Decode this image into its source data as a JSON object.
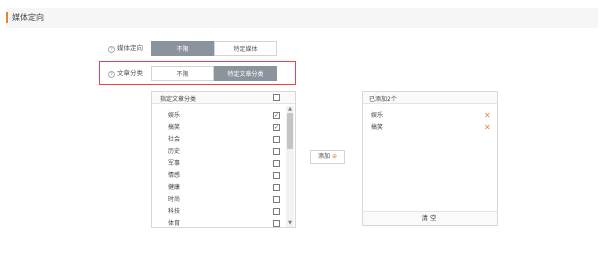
{
  "header": {
    "title": "媒体定向"
  },
  "media_targeting": {
    "label": "媒体定向",
    "options": [
      {
        "label": "不限",
        "active": true
      },
      {
        "label": "特定媒体",
        "active": false
      }
    ]
  },
  "article_category": {
    "label": "文章分类",
    "options": [
      {
        "label": "不限",
        "active": false
      },
      {
        "label": "特定文章分类",
        "active": true
      }
    ]
  },
  "category_list": {
    "header_label": "指定文章分类",
    "items": [
      {
        "label": "娱乐",
        "checked": true
      },
      {
        "label": "搞笑",
        "checked": true
      },
      {
        "label": "社会",
        "checked": false
      },
      {
        "label": "历史",
        "checked": false
      },
      {
        "label": "军事",
        "checked": false
      },
      {
        "label": "情感",
        "checked": false
      },
      {
        "label": "健康",
        "checked": false
      },
      {
        "label": "时尚",
        "checked": false
      },
      {
        "label": "科技",
        "checked": false
      },
      {
        "label": "体育",
        "checked": false
      }
    ]
  },
  "add_button": {
    "label": "添加"
  },
  "added_panel": {
    "header_label": "已添加2个",
    "items": [
      {
        "label": "娱乐"
      },
      {
        "label": "搞笑"
      }
    ],
    "clear_label": "清空"
  },
  "colors": {
    "accent": "#e9832c",
    "active_segment": "#8b949c",
    "highlight_border": "#e3454a"
  },
  "icons": {
    "help": "question-circle-icon",
    "checked": "checkmark-icon",
    "remove": "close-icon",
    "add": "plus-circle-icon"
  }
}
